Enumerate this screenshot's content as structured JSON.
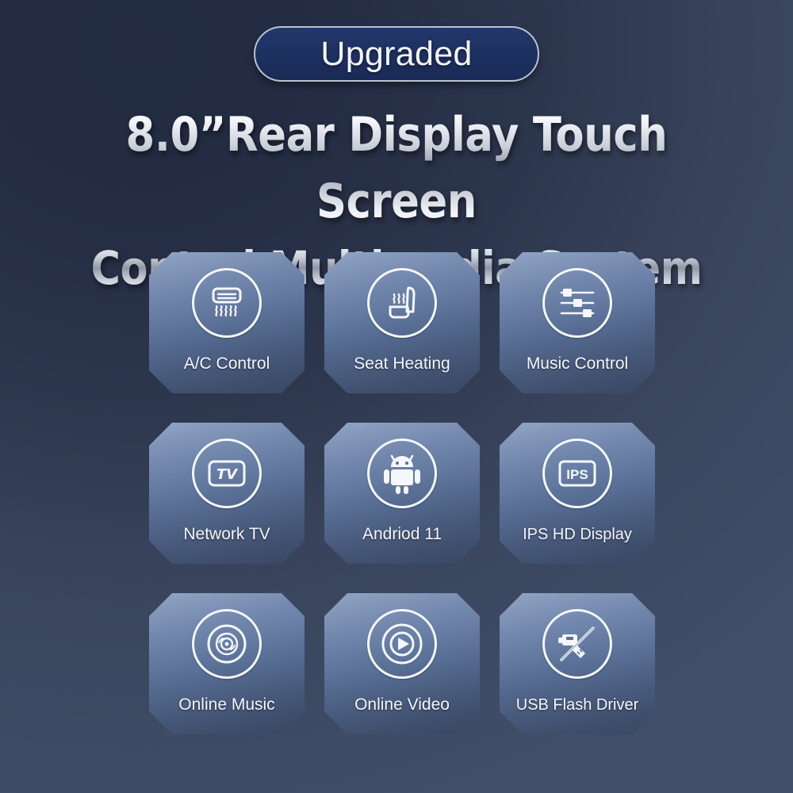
{
  "badge": {
    "label": "Upgraded",
    "fill": "#1d3060",
    "border": "#b9c3d4"
  },
  "heading": {
    "line1": "8.0”Rear Display Touch Screen",
    "line2": "Control Multimedia System"
  },
  "background": {
    "from": "#222b41",
    "to": "#414e68"
  },
  "tile_style": {
    "fill_top": "#93a6c6",
    "fill_bottom": "#394862",
    "border_top": "#e9eff7",
    "border_bottom": "#7fb5e8",
    "icon_color": "#f4f7fb",
    "label_color": "#f4f6fa"
  },
  "features": [
    {
      "label": "A/C Control",
      "icon": "air-conditioner-icon"
    },
    {
      "label": "Seat Heating",
      "icon": "heated-seat-icon"
    },
    {
      "label": "Music Control",
      "icon": "equalizer-sliders-icon"
    },
    {
      "label": "Network TV",
      "icon": "tv-screen-icon"
    },
    {
      "label": "Andriod 11",
      "icon": "android-robot-icon"
    },
    {
      "label": "IPS HD Display",
      "icon": "ips-screen-icon"
    },
    {
      "label": "Online Music",
      "icon": "vinyl-disc-icon"
    },
    {
      "label": "Online Video",
      "icon": "play-button-icon"
    },
    {
      "label": "USB Flash Driver",
      "icon": "usb-flash-drive-icon"
    }
  ]
}
